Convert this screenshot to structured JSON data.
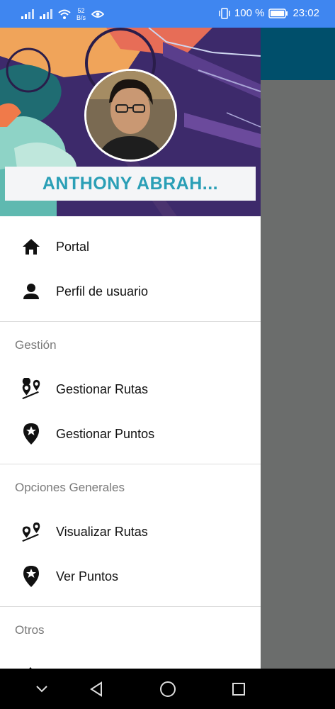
{
  "status_bar": {
    "net_speed_value": "52",
    "net_speed_unit": "B/s",
    "battery_percent": "100 %",
    "time": "23:02"
  },
  "drawer": {
    "user_name": "ANTHONY ABRAH...",
    "items_top": [
      {
        "label": "Portal",
        "icon": "home-icon"
      },
      {
        "label": "Perfil de usuario",
        "icon": "person-icon"
      }
    ],
    "section_gestion": {
      "title": "Gestión",
      "items": [
        {
          "label": "Gestionar Rutas",
          "icon": "route-icon"
        },
        {
          "label": "Gestionar Puntos",
          "icon": "star-pin-icon"
        }
      ]
    },
    "section_opciones": {
      "title": "Opciones Generales",
      "items": [
        {
          "label": "Visualizar Rutas",
          "icon": "route-icon"
        },
        {
          "label": "Ver Puntos",
          "icon": "star-pin-icon"
        }
      ]
    },
    "section_otros": {
      "title": "Otros"
    }
  },
  "colors": {
    "status_bar": "#3f86f0",
    "app_bar": "#004f6b",
    "user_name": "#2a9fb6",
    "scrim": "#6b6d6c"
  }
}
